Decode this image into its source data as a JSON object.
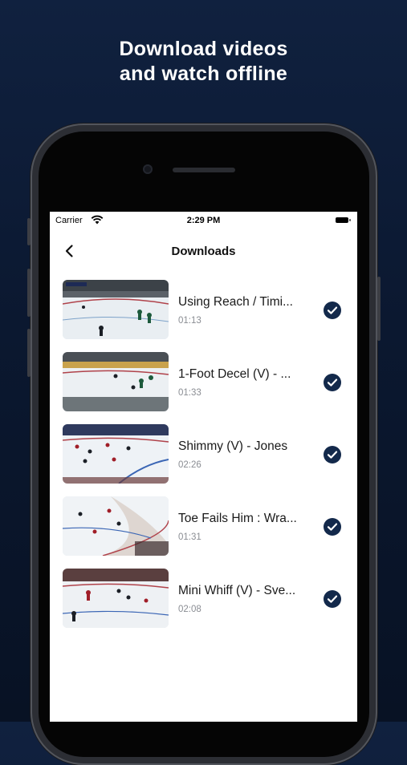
{
  "headline": {
    "line1": "Download videos",
    "line2": "and watch offline"
  },
  "status_bar": {
    "carrier": "Carrier",
    "time": "2:29 PM"
  },
  "nav": {
    "title": "Downloads",
    "back_icon": "chevron-left-icon"
  },
  "downloads": [
    {
      "title": "Using Reach / Timing",
      "display_title": "Using Reach / Timi...",
      "duration": "01:13",
      "downloaded": true
    },
    {
      "title": "1-Foot Decel (V)",
      "display_title": "1-Foot Decel (V) - ...",
      "duration": "01:33",
      "downloaded": true
    },
    {
      "title": "Shimmy (V) - Jones",
      "display_title": "Shimmy (V) - Jones",
      "duration": "02:26",
      "downloaded": true
    },
    {
      "title": "Toe Fails Him : Wra...",
      "display_title": "Toe Fails Him  : Wra...",
      "duration": "01:31",
      "downloaded": true
    },
    {
      "title": "Mini Whiff (V) - Sve...",
      "display_title": "Mini Whiff (V) - Sve...",
      "duration": "02:08",
      "downloaded": true
    }
  ],
  "colors": {
    "background_top": "#10213f",
    "background_bottom": "#081224",
    "check_fill": "#13294b"
  }
}
